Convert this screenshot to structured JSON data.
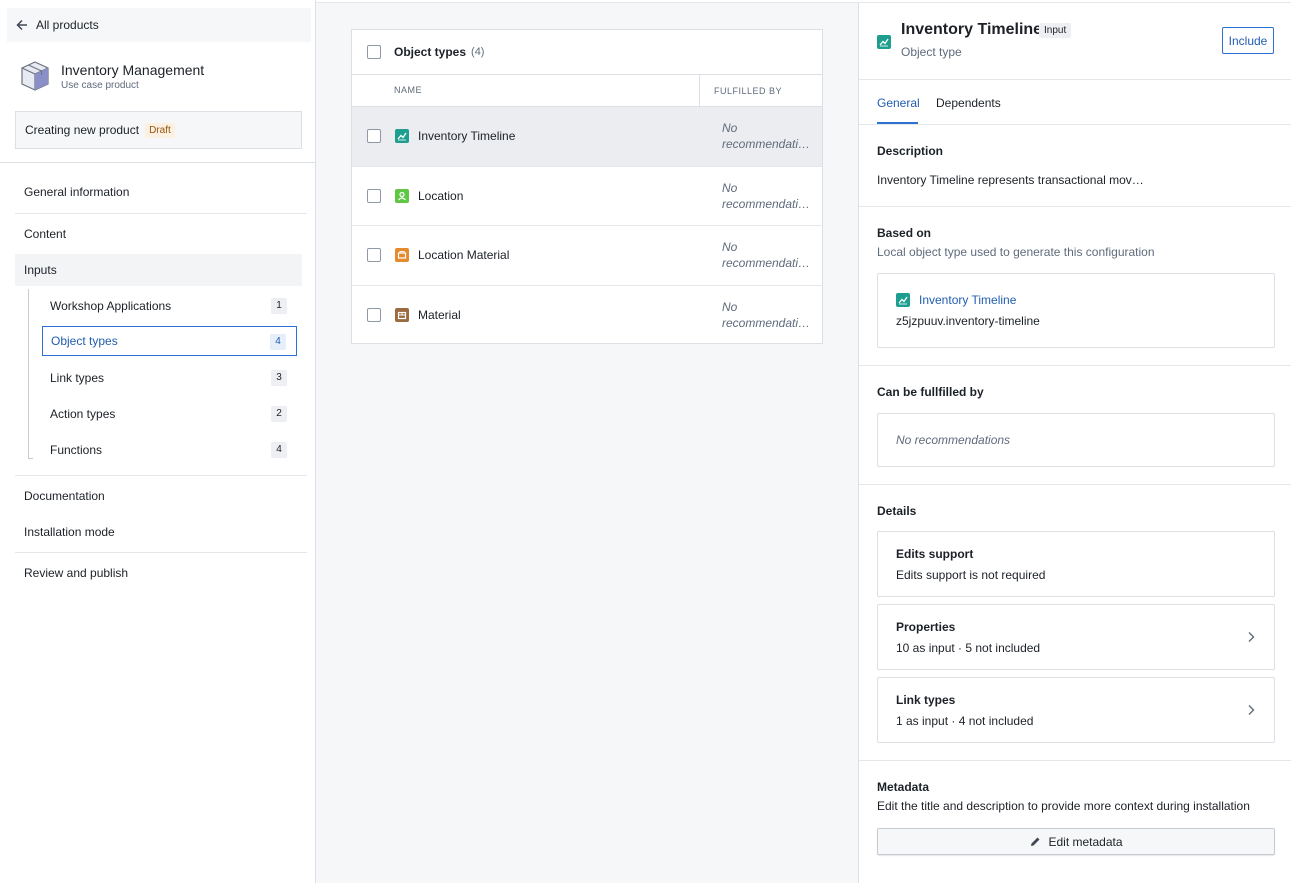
{
  "sidebar": {
    "back_label": "All products",
    "product": {
      "title": "Inventory Management",
      "subtitle": "Use case product"
    },
    "status": {
      "label": "Creating new product",
      "badge": "Draft"
    },
    "nav": [
      {
        "label": "General information"
      },
      {
        "label": "Content"
      },
      {
        "label": "Inputs"
      },
      {
        "label": "Documentation"
      },
      {
        "label": "Installation mode"
      },
      {
        "label": "Review and publish"
      }
    ],
    "inputs": [
      {
        "label": "Workshop Applications",
        "count": "1"
      },
      {
        "label": "Object types",
        "count": "4"
      },
      {
        "label": "Link types",
        "count": "3"
      },
      {
        "label": "Action types",
        "count": "2"
      },
      {
        "label": "Functions",
        "count": "4"
      }
    ]
  },
  "table": {
    "title": "Object types",
    "count": "(4)",
    "columns": {
      "name": "NAME",
      "fulfilled": "FULFILLED BY"
    },
    "rows": [
      {
        "name": "Inventory Timeline",
        "fulfilled_l1": "No",
        "fulfilled_l2": "recommendati…",
        "icon": "timeline-chart-icon",
        "color": "#1d9e8f"
      },
      {
        "name": "Location",
        "fulfilled_l1": "No",
        "fulfilled_l2": "recommendati…",
        "icon": "location-person-icon",
        "color": "#5fc744"
      },
      {
        "name": "Location Material",
        "fulfilled_l1": "No",
        "fulfilled_l2": "recommendati…",
        "icon": "location-material-icon",
        "color": "#e68a2e"
      },
      {
        "name": "Material",
        "fulfilled_l1": "No",
        "fulfilled_l2": "recommendati…",
        "icon": "material-box-icon",
        "color": "#9a6b3f"
      }
    ]
  },
  "panel": {
    "title": "Inventory Timeline",
    "badge": "Input",
    "subtitle": "Object type",
    "include_label": "Include",
    "tabs": [
      "General",
      "Dependents"
    ],
    "description": {
      "heading": "Description",
      "text": "Inventory Timeline represents transactional mov…"
    },
    "based_on": {
      "heading": "Based on",
      "text": "Local object type used to generate this configuration",
      "link": "Inventory Timeline",
      "api_name": "z5jzpuuv.inventory-timeline"
    },
    "fulfilled": {
      "heading": "Can be fullfilled by",
      "empty": "No recommendations"
    },
    "details": {
      "heading": "Details",
      "edits": {
        "title": "Edits support",
        "text": "Edits support is not required"
      },
      "properties": {
        "title": "Properties",
        "text": "10 as input · 5 not included"
      },
      "link_types": {
        "title": "Link types",
        "text": "1 as input · 4 not included"
      }
    },
    "metadata": {
      "heading": "Metadata",
      "text": "Edit the title and description to provide more context during installation",
      "button": "Edit metadata"
    }
  }
}
